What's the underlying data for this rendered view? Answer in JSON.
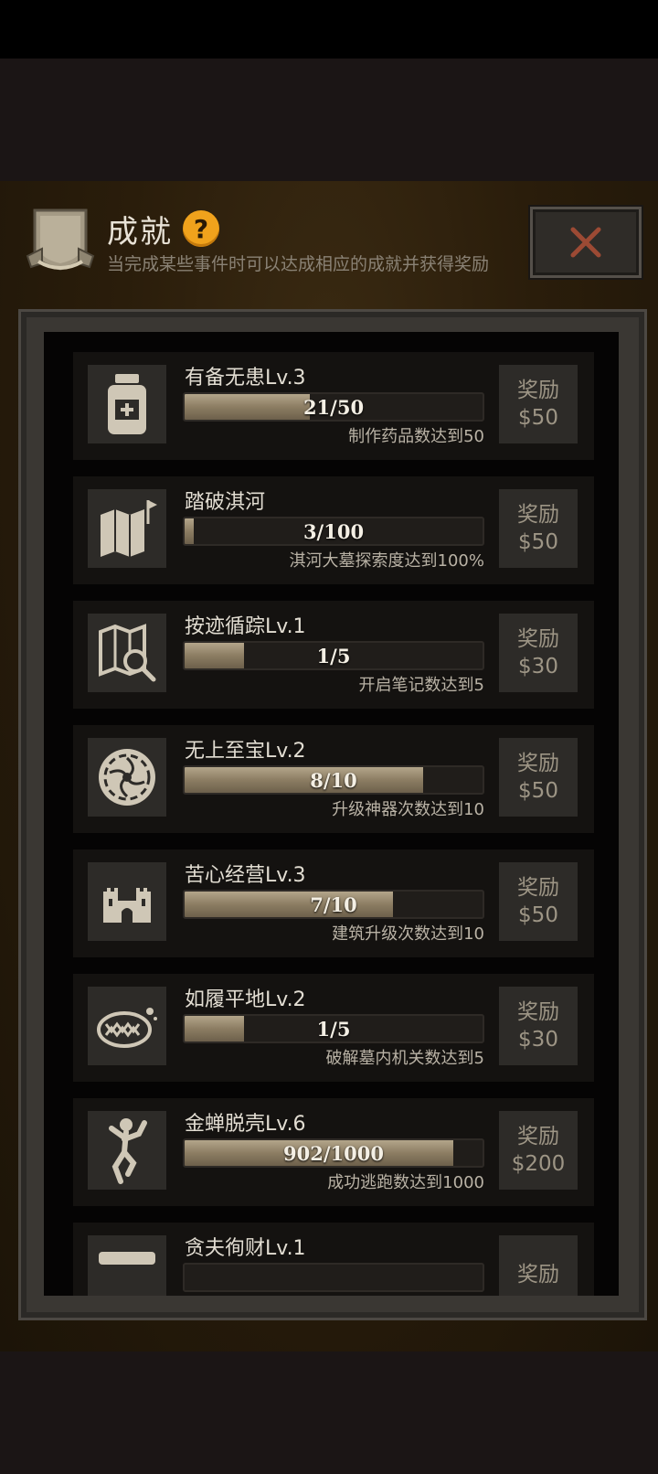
{
  "header": {
    "title": "成就",
    "subtitle": "当完成某些事件时可以达成相应的成就并获得奖励"
  },
  "achievements": [
    {
      "name": "有备无患Lv.3",
      "progress_text": "21/50",
      "progress": 0.42,
      "desc": "制作药品数达到50",
      "reward_label": "奖励",
      "reward_value": "$50",
      "icon": "medicine-bottle-icon"
    },
    {
      "name": "踏破淇河",
      "progress_text": "3/100",
      "progress": 0.03,
      "desc": "淇河大墓探索度达到100%",
      "reward_label": "奖励",
      "reward_value": "$50",
      "icon": "map-flag-icon"
    },
    {
      "name": "按迹循踪Lv.1",
      "progress_text": "1/5",
      "progress": 0.2,
      "desc": "开启笔记数达到5",
      "reward_label": "奖励",
      "reward_value": "$30",
      "icon": "map-search-icon"
    },
    {
      "name": "无上至宝Lv.2",
      "progress_text": "8/10",
      "progress": 0.8,
      "desc": "升级神器次数达到10",
      "reward_label": "奖励",
      "reward_value": "$50",
      "icon": "ornament-disc-icon"
    },
    {
      "name": "苦心经营Lv.3",
      "progress_text": "7/10",
      "progress": 0.7,
      "desc": "建筑升级次数达到10",
      "reward_label": "奖励",
      "reward_value": "$50",
      "icon": "castle-icon"
    },
    {
      "name": "如履平地Lv.2",
      "progress_text": "1/5",
      "progress": 0.2,
      "desc": "破解墓内机关数达到5",
      "reward_label": "奖励",
      "reward_value": "$30",
      "icon": "trap-icon"
    },
    {
      "name": "金蝉脱壳Lv.6",
      "progress_text": "902/1000",
      "progress": 0.902,
      "desc": "成功逃跑数达到1000",
      "reward_label": "奖励",
      "reward_value": "$200",
      "icon": "running-figure-icon"
    },
    {
      "name": "贪夫徇财Lv.1",
      "progress_text": "",
      "progress": 0,
      "desc": "",
      "reward_label": "奖励",
      "reward_value": "",
      "icon": "chest-icon"
    }
  ]
}
